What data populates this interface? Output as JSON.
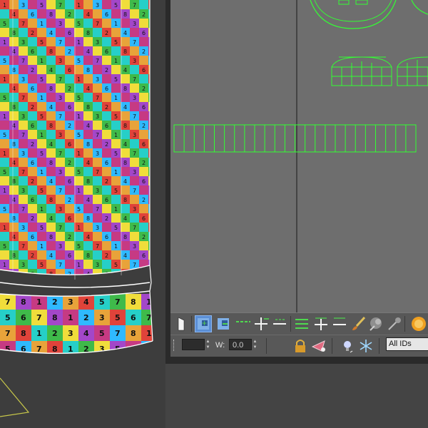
{
  "viewport": {
    "checker_top_rows": [
      [
        "1",
        "2",
        "3",
        "4",
        "5",
        "6",
        "7",
        "8"
      ],
      [
        "3",
        "4",
        "5",
        "6",
        "7",
        "8",
        "1",
        "2"
      ],
      [
        "5",
        "6",
        "7",
        "8",
        "1",
        "2",
        "3",
        "4"
      ],
      [
        "7",
        "8",
        "1",
        "2",
        "3",
        "4",
        "5",
        "6"
      ]
    ],
    "checker_colors": [
      "#e0433a",
      "#f0dd3b",
      "#2fb9ff",
      "#26cfc8",
      "#a347c9",
      "#e8a33a",
      "#3fba4a",
      "#c63a83"
    ],
    "base_band": {
      "row1": [
        "7",
        "8",
        "1",
        "2",
        "3",
        "4",
        "5"
      ],
      "row2": [
        "5",
        "6",
        "7",
        "8",
        "1",
        "2",
        "3"
      ]
    },
    "wire_color": "#ffffff",
    "gizmo_color": "#c8c84a"
  },
  "uv_editor": {
    "canvas_bg": "#6e6e6e",
    "wire_color": "#33ff33"
  },
  "toolbar1": {
    "icons": [
      "cursor-icon",
      "move-plus-icon",
      "move-minus-icon",
      "grow-loop-icon",
      "shrink-loop-icon",
      "grow-ring-icon",
      "shrink-ring-icon",
      "paint-brush-icon",
      "soft-select-icon",
      "hide-icon",
      "render-icon"
    ]
  },
  "toolbar2": {
    "u_value": "",
    "w_label": "W:",
    "w_value": "0.0",
    "ids_select": "All IDs"
  }
}
